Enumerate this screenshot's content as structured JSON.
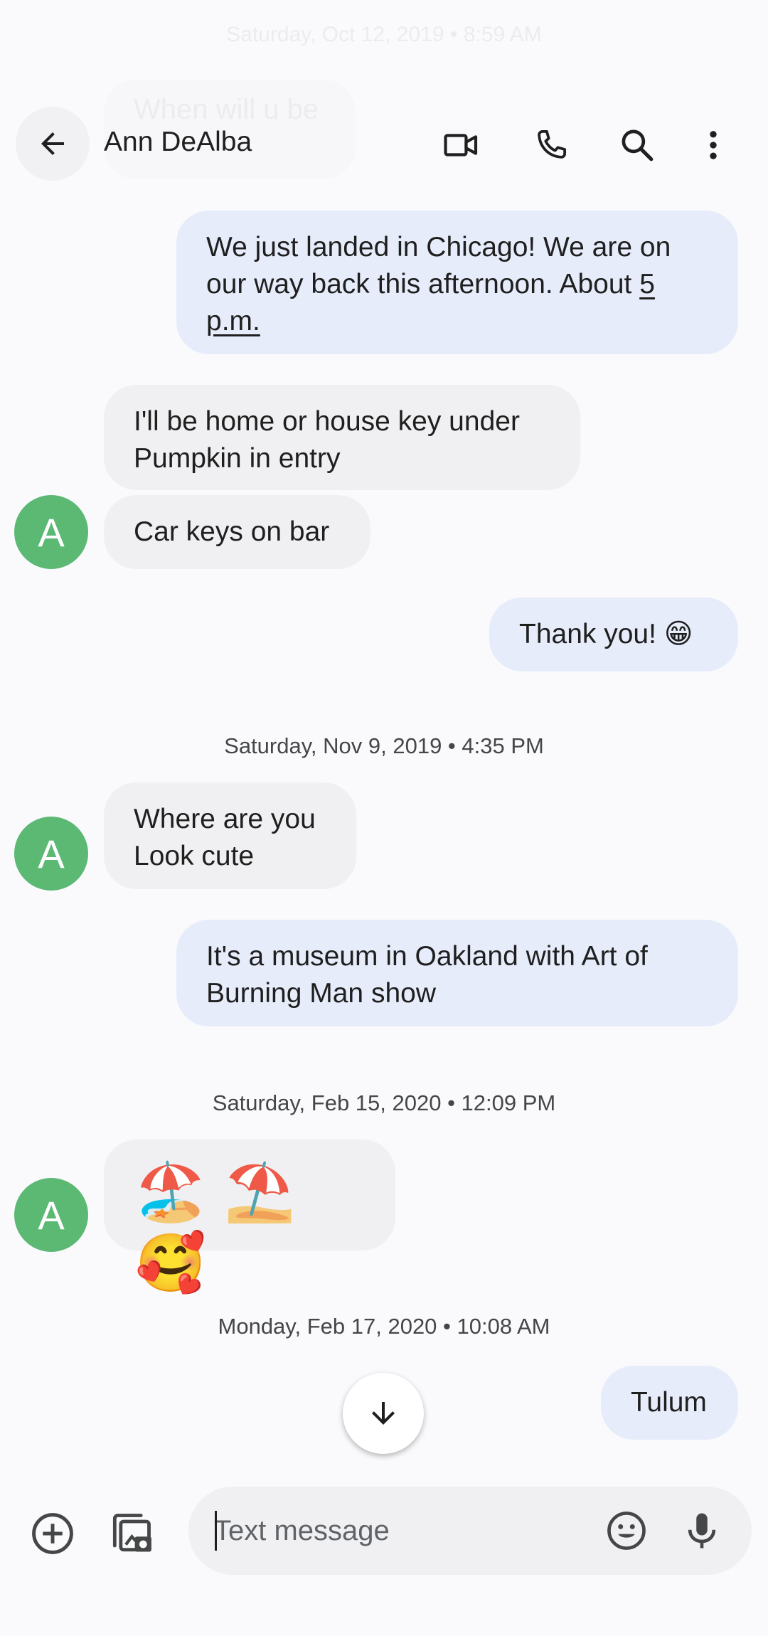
{
  "faded": {
    "timestamp": "Saturday, Oct 12, 2019 • 8:59 AM",
    "message": "When will u be"
  },
  "header": {
    "contact_name": "Ann DeAlba",
    "icons": [
      "back-arrow-icon",
      "video-call-icon",
      "phone-icon",
      "search-icon",
      "more-vert-icon"
    ]
  },
  "conversation": {
    "msg1": {
      "line1": "We just landed in Chicago! We are on",
      "line2a": "our way back this afternoon. About ",
      "line2b": "5",
      "line3": "p.m."
    },
    "msg2": {
      "line1": "I'll be home or house key under",
      "line2": "Pumpkin in entry"
    },
    "msg3": {
      "text": "Car keys on bar"
    },
    "msg4": {
      "text": "Thank you! 😁"
    },
    "ts1": "Saturday, Nov 9, 2019 • 4:35 PM",
    "msg5": {
      "line1": "Where are you",
      "line2": "Look cute"
    },
    "msg6": {
      "line1": "It's a museum in Oakland with Art of",
      "line2": "Burning Man show"
    },
    "ts2": "Saturday, Feb 15, 2020 • 12:09 PM",
    "msg7": {
      "text": "🏖️ ⛱️ 🥰"
    },
    "ts3": "Monday, Feb 17, 2020 • 10:08 AM",
    "msg8": {
      "text": "Tulum"
    },
    "avatar_letter": "A"
  },
  "composer": {
    "placeholder": "Text message",
    "value": ""
  },
  "colors": {
    "outgoing_bubble": "#e6ecfa",
    "incoming_bubble": "#f0f0f2",
    "avatar": "#5bb974",
    "background": "#fafafd"
  }
}
